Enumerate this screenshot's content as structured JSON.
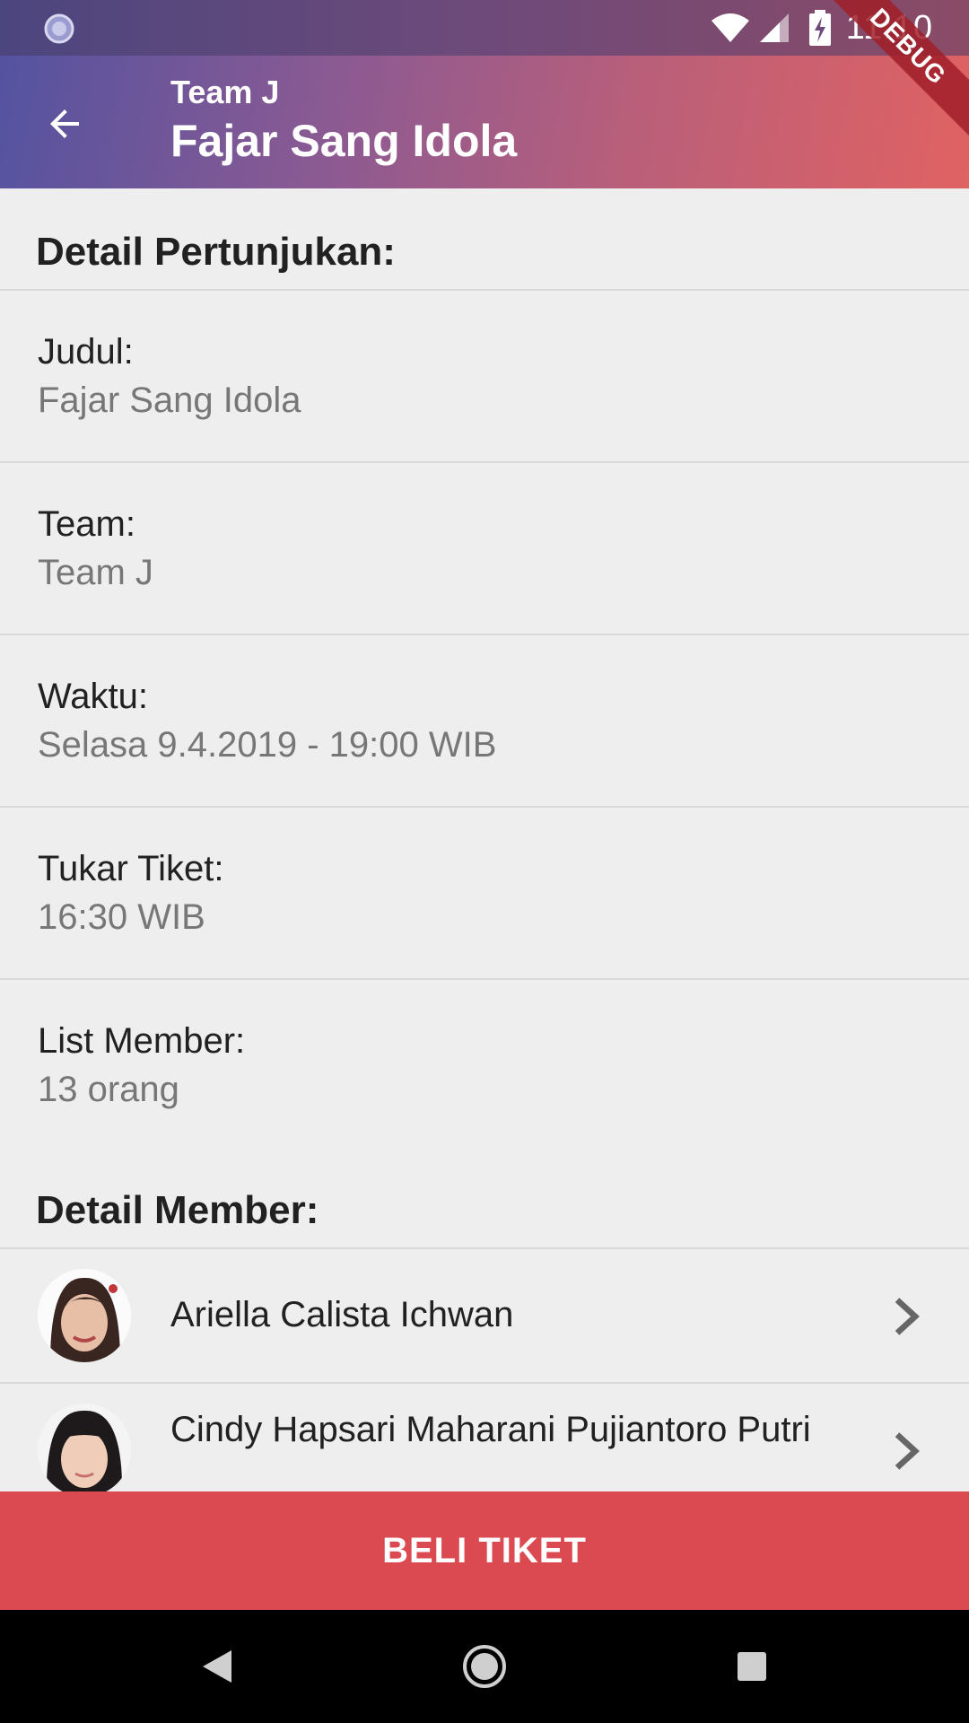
{
  "status_bar": {
    "time": "11:10",
    "icons": [
      "loading-icon",
      "wifi-icon",
      "signal-icon",
      "battery-charging-icon"
    ]
  },
  "app_bar": {
    "subtitle": "Team J",
    "title": "Fajar Sang Idola",
    "back_icon": "arrow-back-icon",
    "debug_label": "DEBUG"
  },
  "detail_section": {
    "header": "Detail Pertunjukan:",
    "rows": [
      {
        "label": "Judul:",
        "value": "Fajar Sang Idola"
      },
      {
        "label": "Team:",
        "value": "Team J"
      },
      {
        "label": "Waktu:",
        "value": "Selasa 9.4.2019 - 19:00 WIB"
      },
      {
        "label": "Tukar Tiket:",
        "value": "16:30 WIB"
      },
      {
        "label": "List Member:",
        "value": "13 orang"
      }
    ]
  },
  "member_section": {
    "header": "Detail Member:",
    "members": [
      {
        "name": "Ariella Calista Ichwan"
      },
      {
        "name": "Cindy Hapsari Maharani Pujiantoro Putri"
      }
    ]
  },
  "buy_button": {
    "label": "BELI TIKET"
  },
  "nav_bar": {
    "icons": [
      "back-triangle-icon",
      "home-circle-icon",
      "recents-square-icon"
    ]
  },
  "colors": {
    "accent": "#da4a50",
    "app_bar_start": "#5453a0",
    "app_bar_end": "#e06262",
    "background": "#eeeeee"
  }
}
